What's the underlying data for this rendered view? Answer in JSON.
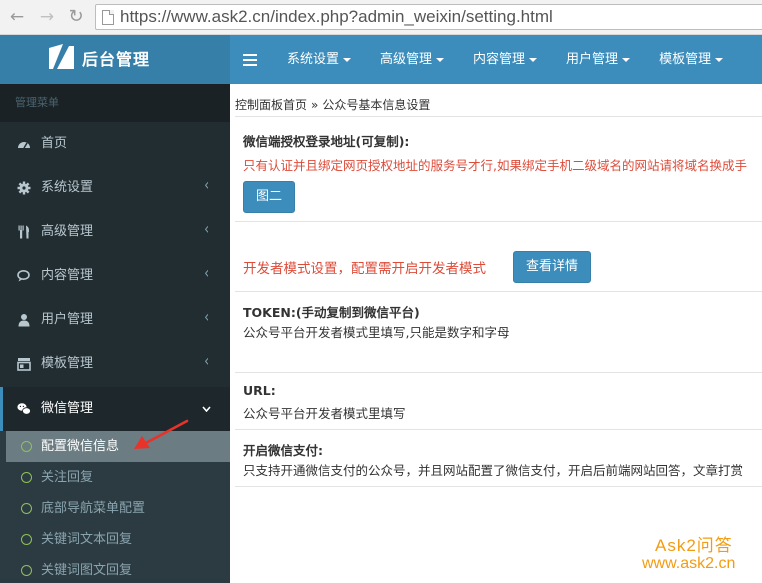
{
  "browser": {
    "url_text": "https://www.ask2.cn/index.php?admin_weixin/setting.html"
  },
  "header": {
    "logo_text": "后台管理",
    "nav": [
      {
        "label": "系统设置"
      },
      {
        "label": "高级管理"
      },
      {
        "label": "内容管理"
      },
      {
        "label": "用户管理"
      },
      {
        "label": "模板管理"
      }
    ]
  },
  "sidebar": {
    "header": "管理菜单",
    "items": [
      {
        "label": "首页",
        "icon": "dashboard-icon"
      },
      {
        "label": "系统设置",
        "icon": "gear-icon"
      },
      {
        "label": "高级管理",
        "icon": "cutlery-icon"
      },
      {
        "label": "内容管理",
        "icon": "comments-icon"
      },
      {
        "label": "用户管理",
        "icon": "user-icon"
      },
      {
        "label": "模板管理",
        "icon": "template-icon"
      },
      {
        "label": "微信管理",
        "icon": "wechat-icon"
      }
    ],
    "submenu": [
      {
        "label": "配置微信信息"
      },
      {
        "label": "关注回复"
      },
      {
        "label": "底部导航菜单配置"
      },
      {
        "label": "关键词文本回复"
      },
      {
        "label": "关键词图文回复"
      }
    ]
  },
  "content": {
    "breadcrumb_home": "控制面板首页",
    "breadcrumb_sep": "»",
    "breadcrumb_current": "公众号基本信息设置",
    "auth_url_label": "微信端授权登录地址(可复制):",
    "auth_url_note": "只有认证并且绑定网页授权地址的服务号才行,如果绑定手机二级域名的网站请将域名换成手",
    "auth_button": "图二",
    "dev_mode_text": "开发者模式设置，配置需开启开发者模式",
    "dev_mode_button": "查看详情",
    "token_label": "TOKEN:(手动复制到微信平台)",
    "token_desc": "公众号平台开发者模式里填写,只能是数字和字母",
    "url_label": "URL:",
    "url_desc": "公众号平台开发者模式里填写",
    "pay_label": "开启微信支付:",
    "pay_desc": "只支持开通微信支付的公众号，并且网站配置了微信支付，开启后前端网站回答，文章打赏"
  },
  "watermark": {
    "line1": "Ask2问答",
    "line2": "www.ask2.cn"
  },
  "colors": {
    "header": "#3c8dbc",
    "logo_bg": "#367fa9",
    "sidebar": "#222d32",
    "submenu": "#2c3b41",
    "warning_text": "#dd4b39",
    "watermark": "#f39c12",
    "annotation_arrow": "#e8322a"
  }
}
